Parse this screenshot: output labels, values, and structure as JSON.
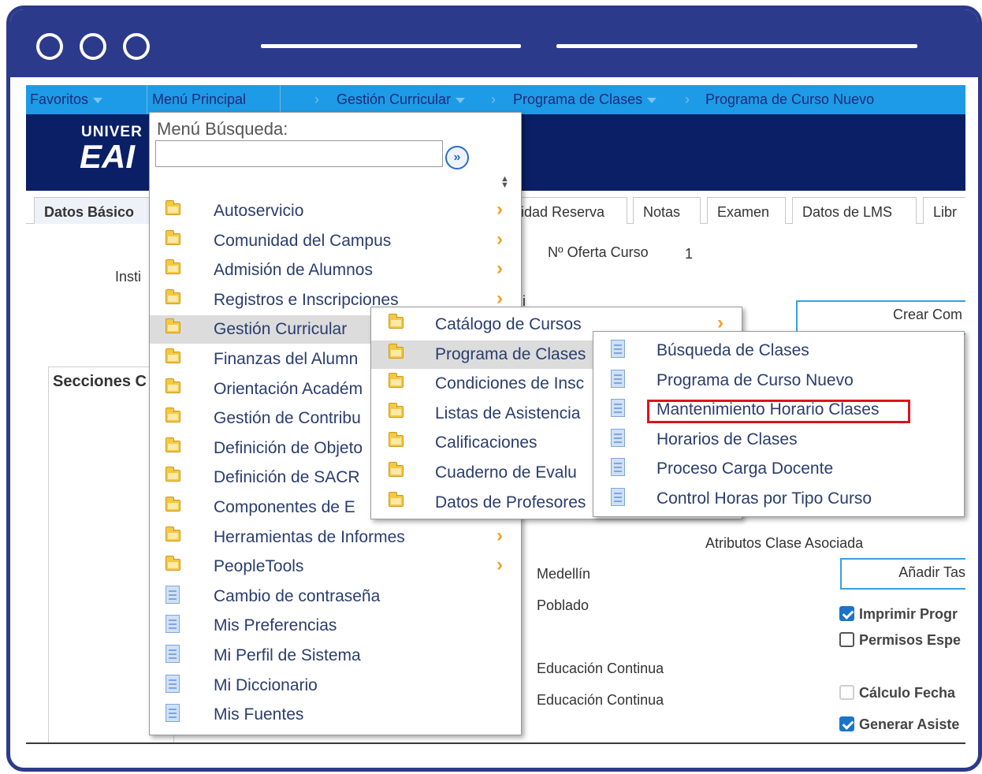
{
  "nav": {
    "favoritos": "Favoritos",
    "menu_principal": "Menú Principal",
    "gestion_curricular": "Gestión Curricular",
    "programa_de_clases": "Programa de Clases",
    "programa_curso_nuevo": "Programa de Curso Nuevo"
  },
  "banner": {
    "logo_top": "UNIVER",
    "logo_big": "EAI"
  },
  "tabs": [
    "Datos Básico",
    "idad Reserva",
    "Notas",
    "Examen",
    "Datos de LMS",
    "Libr"
  ],
  "content": {
    "oferta_label": "Nº Oferta Curso",
    "oferta_value": "1",
    "insti": "Insti",
    "crear_btn": "Crear Com",
    "secciones": "Secciones C",
    "atributos": "Atributos Clase Asociada",
    "medellin": "Medellín",
    "poblado": "Poblado",
    "anadir_btn": "Añadir Tas",
    "edu1": "Educación Continua",
    "edu2": "Educación Continua",
    "chk_imprimir": "Imprimir Progr",
    "chk_permisos": "Permisos Espe",
    "chk_calculo": "Cálculo Fecha",
    "chk_generar": "Generar Asiste",
    "stub_i": "i"
  },
  "menu1": {
    "search_label": "Menú Búsqueda:",
    "search_value": "",
    "go_symbol": "»",
    "items": [
      {
        "label": "Autoservicio",
        "icon": "folder-icon"
      },
      {
        "label": "Comunidad del Campus",
        "icon": "folder-icon"
      },
      {
        "label": "Admisión de Alumnos",
        "icon": "folder-icon"
      },
      {
        "label": "Registros e Inscripciones",
        "icon": "folder-icon"
      },
      {
        "label": "Gestión Curricular",
        "icon": "folder-icon"
      },
      {
        "label": "Finanzas del Alumn",
        "icon": "folder-icon"
      },
      {
        "label": "Orientación Académ",
        "icon": "folder-icon"
      },
      {
        "label": "Gestión de Contribu",
        "icon": "folder-icon"
      },
      {
        "label": "Definición de Objeto",
        "icon": "folder-icon"
      },
      {
        "label": "Definición de SACR",
        "icon": "folder-icon"
      },
      {
        "label": "Componentes de E",
        "icon": "folder-icon"
      },
      {
        "label": "Herramientas de Informes",
        "icon": "folder-icon"
      },
      {
        "label": "PeopleTools",
        "icon": "folder-icon"
      },
      {
        "label": "Cambio de contraseña",
        "icon": "page-icon"
      },
      {
        "label": "Mis Preferencias",
        "icon": "page-icon"
      },
      {
        "label": "Mi Perfil de Sistema",
        "icon": "page-icon"
      },
      {
        "label": "Mi Diccionario",
        "icon": "page-icon"
      },
      {
        "label": "Mis Fuentes",
        "icon": "page-icon"
      }
    ]
  },
  "menu2": {
    "items": [
      {
        "label": "Catálogo de Cursos"
      },
      {
        "label": "Programa de Clases"
      },
      {
        "label": "Condiciones de Insc"
      },
      {
        "label": "Listas de Asistencia"
      },
      {
        "label": "Calificaciones"
      },
      {
        "label": "Cuaderno de Evalu"
      },
      {
        "label": "Datos de Profesores"
      }
    ]
  },
  "menu3": {
    "items": [
      {
        "label": "Búsqueda de Clases"
      },
      {
        "label": "Programa de Curso Nuevo"
      },
      {
        "label": "Mantenimiento Horario Clases"
      },
      {
        "label": "Horarios de Clases"
      },
      {
        "label": "Proceso Carga Docente"
      },
      {
        "label": "Control Horas por Tipo Curso"
      }
    ]
  },
  "colors": {
    "frame": "#2c3a8c",
    "navbar": "#1e9be6",
    "banner": "#0b1f66",
    "highlight": "#e0101e"
  }
}
